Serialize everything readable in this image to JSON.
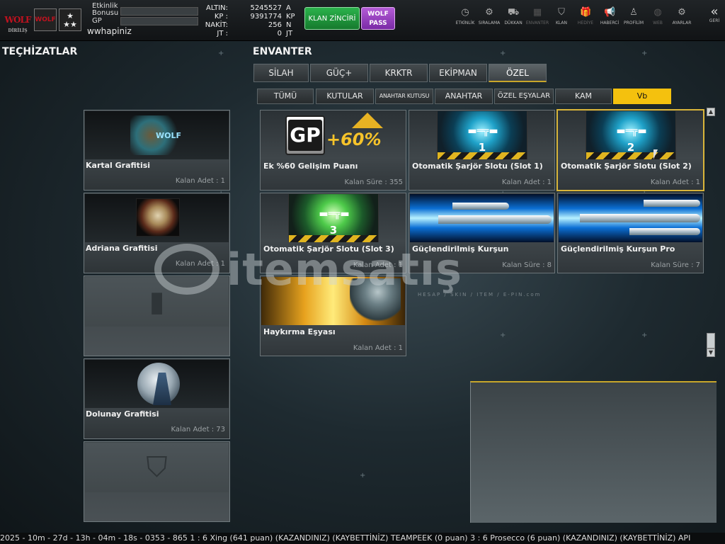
{
  "topbar": {
    "logo": "WOLF",
    "logo_sub": "DİRİLİŞ",
    "badge1": "WOLF",
    "badge2": "★ ★★",
    "bonus_label": "Etkinlik Bonusu",
    "gp_label": "GP",
    "username": "wwhapiniz",
    "currencies": [
      {
        "label": "ALTIN:",
        "value": "5245527",
        "unit": "A"
      },
      {
        "label": "KP :",
        "value": "9391774",
        "unit": "KP"
      },
      {
        "label": "NAKİT:",
        "value": "256",
        "unit": "N"
      },
      {
        "label": "JT :",
        "value": "0",
        "unit": "JT"
      }
    ],
    "klan_button": "KLAN ZİNCİRİ",
    "wolf_pass": "WOLF PASS",
    "nav": [
      {
        "label": "ETKİNLİK",
        "icon": "◷",
        "dim": false
      },
      {
        "label": "SIRALAMA",
        "icon": "⚙",
        "dim": false
      },
      {
        "label": "DÜKKAN",
        "icon": "⛟",
        "dim": false
      },
      {
        "label": "ENVANTER",
        "icon": "▦",
        "dim": true
      },
      {
        "label": "KLAN",
        "icon": "⛉",
        "dim": false
      },
      {
        "label": "HEDİYE",
        "icon": "🎁",
        "dim": true
      },
      {
        "label": "HABERCİ",
        "icon": "📢",
        "dim": false
      },
      {
        "label": "PROFİLİM",
        "icon": "♙",
        "dim": false
      },
      {
        "label": "WEB",
        "icon": "◍",
        "dim": true
      },
      {
        "label": "AYARLAR",
        "icon": "⚙",
        "dim": false
      }
    ],
    "back": "GERİ",
    "back_icon": "«"
  },
  "left": {
    "title": "TEÇHİZATLAR",
    "items": [
      {
        "name": "Kartal Grafitisi",
        "count": "Kalan Adet : 1"
      },
      {
        "name": "Adriana Grafitisi",
        "count": "Kalan Adet : 1"
      },
      {
        "name": "",
        "count": ""
      },
      {
        "name": "Dolunay Grafitisi",
        "count": "Kalan Adet : 73"
      },
      {
        "name": "",
        "count": ""
      }
    ]
  },
  "inventory": {
    "title": "ENVANTER",
    "tabs": [
      "SİLAH",
      "GÜÇ+",
      "KRKTR",
      "EKİPMAN",
      "ÖZEL"
    ],
    "subtabs": [
      "TÜMÜ",
      "KUTULAR",
      "ANAHTAR KUTUSU",
      "ANAHTAR",
      "ÖZEL EŞYALAR",
      "KAM",
      "Vb"
    ],
    "gp_text": "GP",
    "gp_percent": "+60%",
    "items": [
      {
        "name": "Ek %60 Gelişim Puanı",
        "count": "Kalan Süre : 355"
      },
      {
        "name": "Otomatik Şarjör Slotu (Slot 1)",
        "count": "Kalan Adet : 1",
        "num": "1"
      },
      {
        "name": "Otomatik Şarjör Slotu (Slot 2)",
        "count": "Kalan Adet : 1",
        "num": "2"
      },
      {
        "name": "Otomatik Şarjör Slotu (Slot 3)",
        "count": "Kalan Adet : 1",
        "num": "3"
      },
      {
        "name": "Güçlendirilmiş Kurşun",
        "count": "Kalan Süre : 8"
      },
      {
        "name": "Güçlendirilmiş Kurşun Pro",
        "count": "Kalan Süre : 7"
      },
      {
        "name": "Haykırma Eşyası",
        "count": "Kalan Adet : 1"
      }
    ]
  },
  "scroll": {
    "up": "▲",
    "down": "▼"
  },
  "watermark": {
    "text": "itemsatış",
    "sub": "HESAP / SKIN / ITEM / E-PIN.com"
  },
  "ticker": "2025 - 10m - 27d - 13h - 04m - 18s - 0353 - 865   1 : 6 Xing (641 puan) (KAZANDINIZ)        (KAYBETTİNİZ) TEAMPEEK (0 puan) 3 : 6 Prosecco (6 puan) (KAZANDINIZ)        (KAYBETTİNİZ) API"
}
